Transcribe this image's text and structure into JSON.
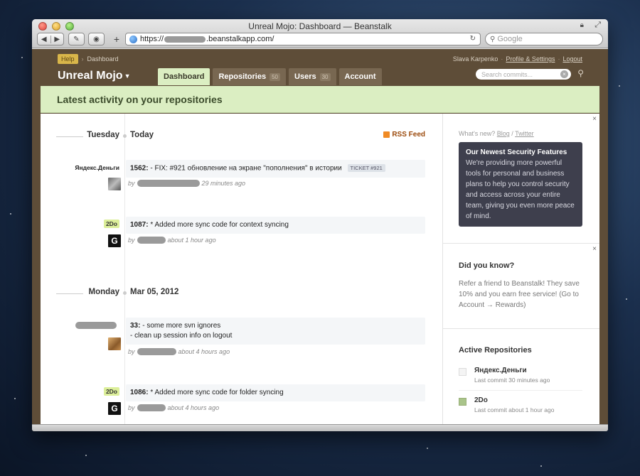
{
  "window": {
    "title": "Unreal Mojo: Dashboard — Beanstalk",
    "url_prefix": "https://",
    "url_suffix": ".beanstalkapp.com/",
    "search_placeholder": "Google"
  },
  "site": {
    "help_label": "Help",
    "breadcrumb": "Dashboard",
    "user_name": "Slava Karpenko",
    "profile_link": "Profile & Settings",
    "logout_link": "Logout",
    "brand": "Unreal Mojo",
    "tabs": [
      {
        "label": "Dashboard",
        "count": "",
        "active": true
      },
      {
        "label": "Repositories",
        "count": "50"
      },
      {
        "label": "Users",
        "count": "30"
      },
      {
        "label": "Account",
        "count": ""
      }
    ],
    "search_placeholder": "Search commits...",
    "banner": "Latest activity on your repositories"
  },
  "feed": {
    "rss_label": "RSS Feed",
    "days": [
      {
        "name": "Tuesday",
        "date": "Today"
      },
      {
        "name": "Monday",
        "date": "Mar 05, 2012"
      }
    ],
    "entries": [
      {
        "repo": "Яндекс.Деньги",
        "rev": "1562:",
        "message": "- FIX: #921 обновление на экране \"пополнения\" в истории",
        "ticket": "TICKET #921",
        "by": "by",
        "time": "29 minutes ago"
      },
      {
        "repo": "2Do",
        "rev": "1087:",
        "message": "* Added more sync code for context syncing",
        "by": "by",
        "time": "about 1 hour ago"
      },
      {
        "repo": "",
        "rev": "33:",
        "message": "- some more svn ignores",
        "message2": "- clean up session info on logout",
        "by": "by",
        "time": "about 4 hours ago"
      },
      {
        "repo": "2Do",
        "rev": "1086:",
        "message": "* Added more sync code for folder syncing",
        "by": "by",
        "time": "about 4 hours ago"
      }
    ]
  },
  "sidebar": {
    "whats_new": "What's new?",
    "blog_link": "Blog",
    "twitter_link": "Twitter",
    "promo_title": "Our Newest Security Features",
    "promo_text": "We're providing more powerful tools for personal and business plans to help you control security and access across your entire team, giving you even more peace of mind.",
    "didyouknow_title": "Did you know?",
    "didyouknow_text": "Refer a friend to Beanstalk! They save 10% and you earn free service! (Go to Account → Rewards)",
    "active_repos_title": "Active Repositories",
    "active_repos": [
      {
        "name": "Яндекс.Деньги",
        "sub": "Last commit 30 minutes ago"
      },
      {
        "name": "2Do",
        "sub": "Last commit about 1 hour ago"
      }
    ]
  },
  "colors": {
    "site_brown": "#5e4d38",
    "banner_green": "#dbeec2",
    "promo_dark": "#3e3f4d"
  }
}
